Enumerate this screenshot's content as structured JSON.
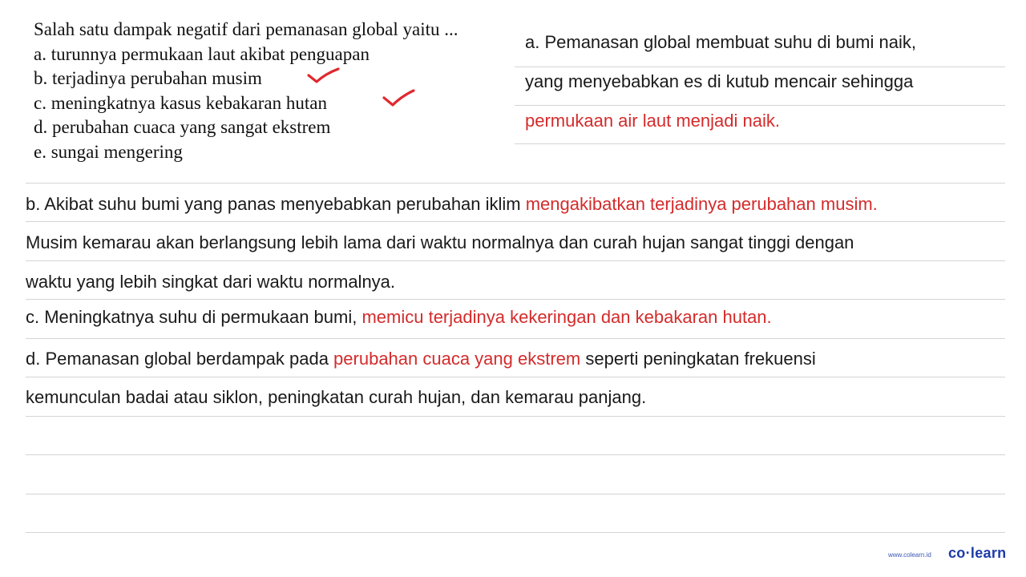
{
  "question": {
    "stem": "Salah satu dampak negatif dari pemanasan global yaitu ...",
    "options": [
      {
        "text": "a. turunnya permukaan laut akibat penguapan",
        "checked": false
      },
      {
        "text": "b. terjadinya perubahan musim",
        "checked": true
      },
      {
        "text": "c. meningkatnya kasus kebakaran hutan",
        "checked": true
      },
      {
        "text": "d. perubahan cuaca yang sangat ekstrem",
        "checked": false
      },
      {
        "text": "e. sungai mengering",
        "checked": false
      }
    ]
  },
  "explanation": {
    "a": {
      "line1": "a. Pemanasan global membuat suhu di bumi naik,",
      "line2": "yang menyebabkan es di kutub mencair sehingga",
      "line3_red": "permukaan air laut menjadi naik."
    },
    "b": {
      "line1_plain": "b. Akibat suhu bumi yang panas menyebabkan perubahan iklim ",
      "line1_red": "mengakibatkan terjadinya perubahan musim.",
      "line2": "Musim kemarau akan berlangsung lebih lama dari waktu normalnya dan curah hujan sangat tinggi dengan",
      "line3": "waktu yang lebih singkat dari waktu normalnya."
    },
    "c": {
      "plain": "c. Meningkatnya suhu di permukaan bumi, ",
      "red": "memicu terjadinya kekeringan dan kebakaran hutan."
    },
    "d": {
      "plain1": "d. Pemanasan global berdampak pada ",
      "red": "perubahan cuaca yang ekstrem",
      "plain2": " seperti peningkatan frekuensi",
      "line2": "kemunculan badai atau siklon, peningkatan curah hujan, dan kemarau panjang."
    }
  },
  "footer": {
    "url": "www.colearn.id",
    "brand": "co·learn"
  },
  "colors": {
    "accent_red": "#d42b2b",
    "check_red": "#e0282e",
    "brand_blue": "#1c3aa9"
  }
}
